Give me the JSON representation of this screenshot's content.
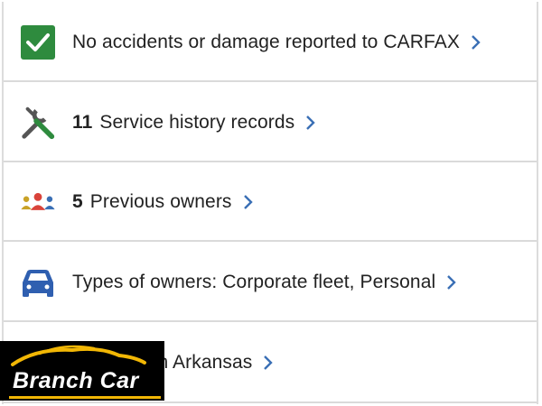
{
  "items": [
    {
      "icon": "check-icon",
      "count": "",
      "label": "No accidents or damage reported to CARFAX"
    },
    {
      "icon": "wrench-screwdriver-icon",
      "count": "11",
      "label": "Service history records"
    },
    {
      "icon": "people-icon",
      "count": "5",
      "label": "Previous owners"
    },
    {
      "icon": "car-icon",
      "count": "",
      "label": "Types of owners: Corporate fleet, Personal"
    },
    {
      "icon": "",
      "count": "",
      "label": "d in Arkansas"
    }
  ],
  "watermark": {
    "text": "Branch Car"
  },
  "colors": {
    "check_green": "#2e8b3e",
    "accent_blue": "#3a6fb5",
    "logo_gold": "#f2b705"
  }
}
